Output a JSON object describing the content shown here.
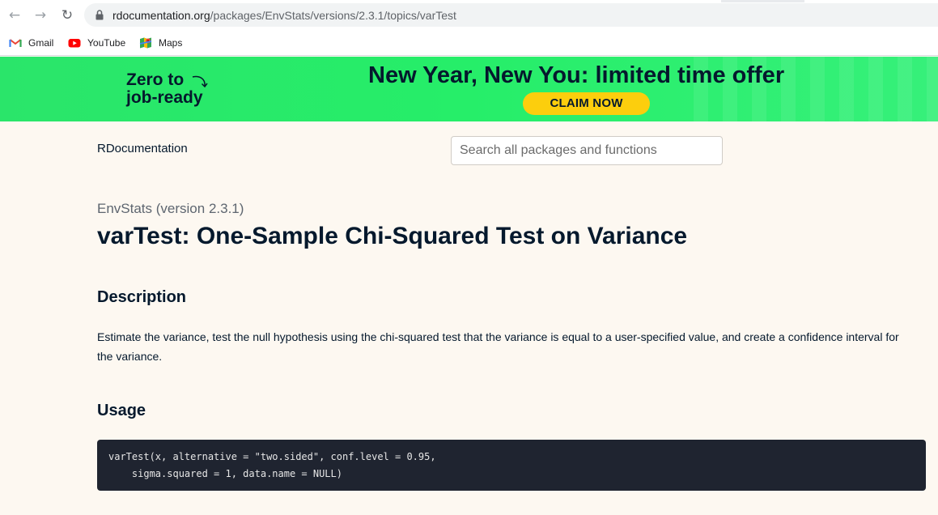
{
  "browser": {
    "url_domain": "rdocumentation.org",
    "url_path": "/packages/EnvStats/versions/2.3.1/topics/varTest",
    "bookmarks": [
      {
        "label": "Gmail",
        "icon": "gmail-icon"
      },
      {
        "label": "YouTube",
        "icon": "youtube-icon"
      },
      {
        "label": "Maps",
        "icon": "maps-icon"
      }
    ]
  },
  "banner": {
    "tagline_line1": "Zero to",
    "tagline_line2": "job-ready",
    "title": "New Year, New You: limited time offer",
    "cta": "CLAIM NOW"
  },
  "header": {
    "logo": "RDocumentation",
    "search_placeholder": "Search all packages and functions"
  },
  "page": {
    "package_version": "EnvStats (version 2.3.1)",
    "title": "varTest: One-Sample Chi-Squared Test on Variance",
    "description_heading": "Description",
    "description": "Estimate the variance, test the null hypothesis using the chi-squared test that the variance is equal to a user-specified value, and create a confidence interval for the variance.",
    "usage_heading": "Usage",
    "usage_code": "varTest(x, alternative = \"two.sided\", conf.level = 0.95, \n    sigma.squared = 1, data.name = NULL)"
  },
  "colors": {
    "banner_green": "#26ee69",
    "cta_yellow": "#fcce0d",
    "navy": "#05192d",
    "page_bg": "#fdf8f1",
    "code_bg": "#1f2430"
  }
}
